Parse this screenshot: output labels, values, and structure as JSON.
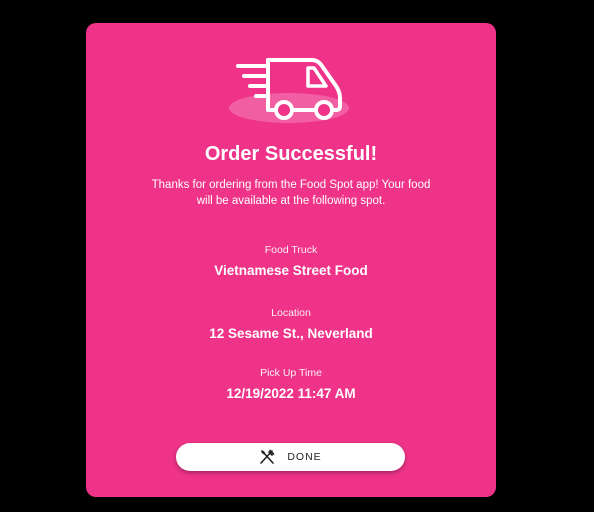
{
  "dialog": {
    "title": "Order Successful!",
    "message": "Thanks for ordering from the Food Spot app! Your food will be available at the following spot.",
    "hero_icon": "delivery-truck-icon",
    "accent_color": "#ee3388"
  },
  "fields": [
    {
      "label": "Food Truck",
      "value": "Vietnamese Street Food"
    },
    {
      "label": "Location",
      "value": "12 Sesame St., Neverland"
    },
    {
      "label": "Pick Up Time",
      "value": "12/19/2022 11:47 AM"
    }
  ],
  "done_button": {
    "label": "DONE",
    "icon": "fork-knife-icon"
  }
}
